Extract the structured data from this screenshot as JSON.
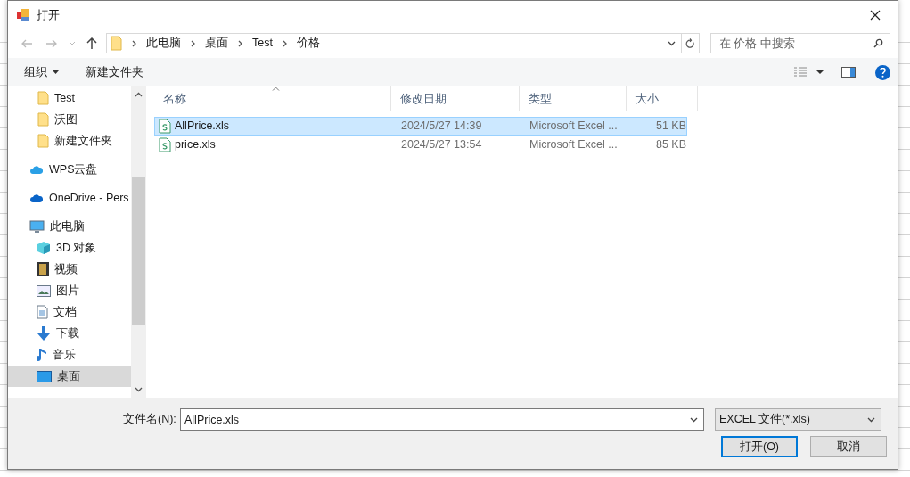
{
  "window": {
    "title": "打开"
  },
  "address_bar": {
    "crumbs": [
      "此电脑",
      "桌面",
      "Test",
      "价格"
    ]
  },
  "search": {
    "placeholder": "在 价格 中搜索"
  },
  "toolbar": {
    "organize": "组织",
    "new_folder": "新建文件夹"
  },
  "nav_pane": {
    "quick_access_children": [
      {
        "label": "Test",
        "kind": "folder",
        "selected": false
      },
      {
        "label": "沃图",
        "kind": "folder",
        "selected": false
      },
      {
        "label": "新建文件夹",
        "kind": "folder",
        "selected": false
      }
    ],
    "items": [
      {
        "label": "WPS云盘",
        "kind": "cloud",
        "selected": false
      },
      {
        "label": "OneDrive - Pers",
        "kind": "onedrive",
        "selected": false
      },
      {
        "label": "此电脑",
        "kind": "pc",
        "selected": false,
        "children": [
          {
            "label": "3D 对象",
            "kind": "cube",
            "selected": false
          },
          {
            "label": "视频",
            "kind": "video",
            "selected": false
          },
          {
            "label": "图片",
            "kind": "picture",
            "selected": false
          },
          {
            "label": "文档",
            "kind": "doc",
            "selected": false
          },
          {
            "label": "下载",
            "kind": "download",
            "selected": false
          },
          {
            "label": "音乐",
            "kind": "music",
            "selected": false
          },
          {
            "label": "桌面",
            "kind": "desktop",
            "selected": true
          }
        ]
      }
    ]
  },
  "file_list": {
    "columns": [
      "名称",
      "修改日期",
      "类型",
      "大小"
    ],
    "rows": [
      {
        "name": "AllPrice.xls",
        "modified": "2024/5/27 14:39",
        "type": "Microsoft Excel ...",
        "size": "51 KB",
        "selected": true
      },
      {
        "name": "price.xls",
        "modified": "2024/5/27 13:54",
        "type": "Microsoft Excel ...",
        "size": "85 KB",
        "selected": false
      }
    ]
  },
  "footer": {
    "filename_label": "文件名(N):",
    "filename_value": "AllPrice.xls",
    "filter": "EXCEL 文件(*.xls)",
    "open_button": "打开(O)",
    "cancel_button": "取消"
  }
}
